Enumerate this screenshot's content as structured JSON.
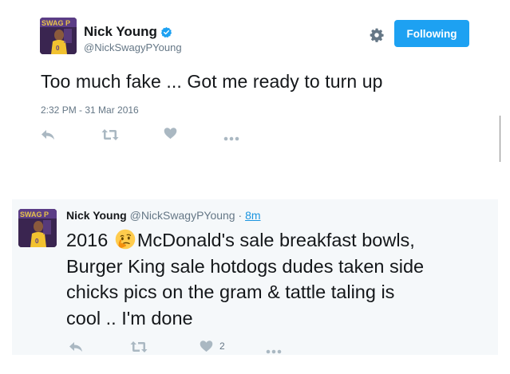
{
  "tweet": {
    "author_name": "Nick Young",
    "author_handle": "@NickSwagyPYoung",
    "follow_button_label": "Following",
    "text": "Too much fake ... Got me ready to turn up",
    "timestamp": "2:32 PM - 31 Mar 2016",
    "icons": [
      "reply-icon",
      "retweet-icon",
      "like-icon",
      "more-icon",
      "gear-icon",
      "verified-badge-icon"
    ]
  },
  "quoted_tweet": {
    "author_name": "Nick Young",
    "author_handle": "@NickSwagyPYoung",
    "separator": "·",
    "time_ago": "8m",
    "text_lines": [
      {
        "before_emoji": "2016 ",
        "emoji": "thinking-face-emoji",
        "after_emoji": "McDonald's sale breakfast bowls,"
      },
      "Burger King sale hotdogs dudes taken side",
      "chicks pics on the gram & tattle taling is",
      "cool .. I'm done"
    ],
    "like_count": "2",
    "icons": [
      "reply-icon",
      "retweet-icon",
      "like-icon",
      "more-icon"
    ]
  },
  "colors": {
    "accent": "#1da1f2",
    "text": "#14171a",
    "muted": "#657786",
    "icon": "#aab8c2",
    "quote_background": "#f5f8fa"
  }
}
